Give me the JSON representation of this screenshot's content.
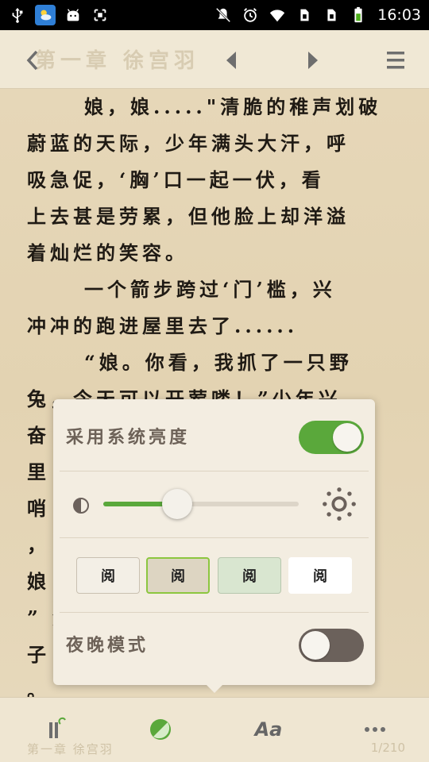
{
  "status_bar": {
    "time": "16:03",
    "left_icons": [
      "usb-icon",
      "weather-icon",
      "android-icon",
      "screenshot-icon"
    ],
    "right_icons": [
      "mute-icon",
      "alarm-icon",
      "wifi-icon",
      "sim1-icon",
      "sim2-icon",
      "battery-icon"
    ]
  },
  "top_bar": {
    "chapter_title": "第一章 徐宫羽"
  },
  "content": {
    "lines": [
      {
        "text": "娘，娘.....\"清脆的稚声划破",
        "indent": true
      },
      {
        "text": "蔚蓝的天际，少年满头大汗，呼",
        "indent": false
      },
      {
        "text": "吸急促，‘胸’口一起一伏，看",
        "indent": false
      },
      {
        "text": "上去甚是劳累，但他脸上却洋溢",
        "indent": false
      },
      {
        "text": "着灿烂的笑容。",
        "indent": false
      },
      {
        "text": "一个箭步跨过‘门’槛，兴",
        "indent": true
      },
      {
        "text": "冲冲的跑进屋里去了......",
        "indent": false
      },
      {
        "text": "“娘。你看，我抓了一只野",
        "indent": true
      },
      {
        "text": "兔，今天可以开荤喽！”少年兴",
        "indent": false
      },
      {
        "text": "奋                          手",
        "indent": false
      },
      {
        "text": "里                          住",
        "indent": false
      },
      {
        "text": "哨                           ",
        "indent": false
      },
      {
        "text": "                            ，",
        "indent": false
      },
      {
        "text": "娘                          ！",
        "indent": false
      },
      {
        "text": "”                          兔",
        "indent": false
      },
      {
        "text": "子                          道",
        "indent": false
      },
      {
        "text": "。",
        "indent": false
      }
    ]
  },
  "popup": {
    "system_brightness_label": "采用系统亮度",
    "system_brightness_on": true,
    "brightness_level": 0.38,
    "theme_glyph": "阅",
    "themes": [
      {
        "name": "theme-cream",
        "bg": "#f3efe6",
        "border": "#c9c0b1"
      },
      {
        "name": "theme-parchment",
        "bg": "#ddd5c2",
        "border": "#8cc63f"
      },
      {
        "name": "theme-green",
        "bg": "#d9e6d0",
        "border": "#b7c7ae"
      },
      {
        "name": "theme-white",
        "bg": "#ffffff",
        "border": "#ffffff"
      }
    ],
    "night_mode_label": "夜晚模式",
    "night_mode_on": false
  },
  "bottom_bar": {
    "font_label": "Aa",
    "footer_chapter": "第一章 徐宫羽",
    "footer_page": "1/210"
  },
  "colors": {
    "accent": "#5aa83b",
    "toggle_off": "#6b615b",
    "page_bg": "#e6d7b8"
  }
}
